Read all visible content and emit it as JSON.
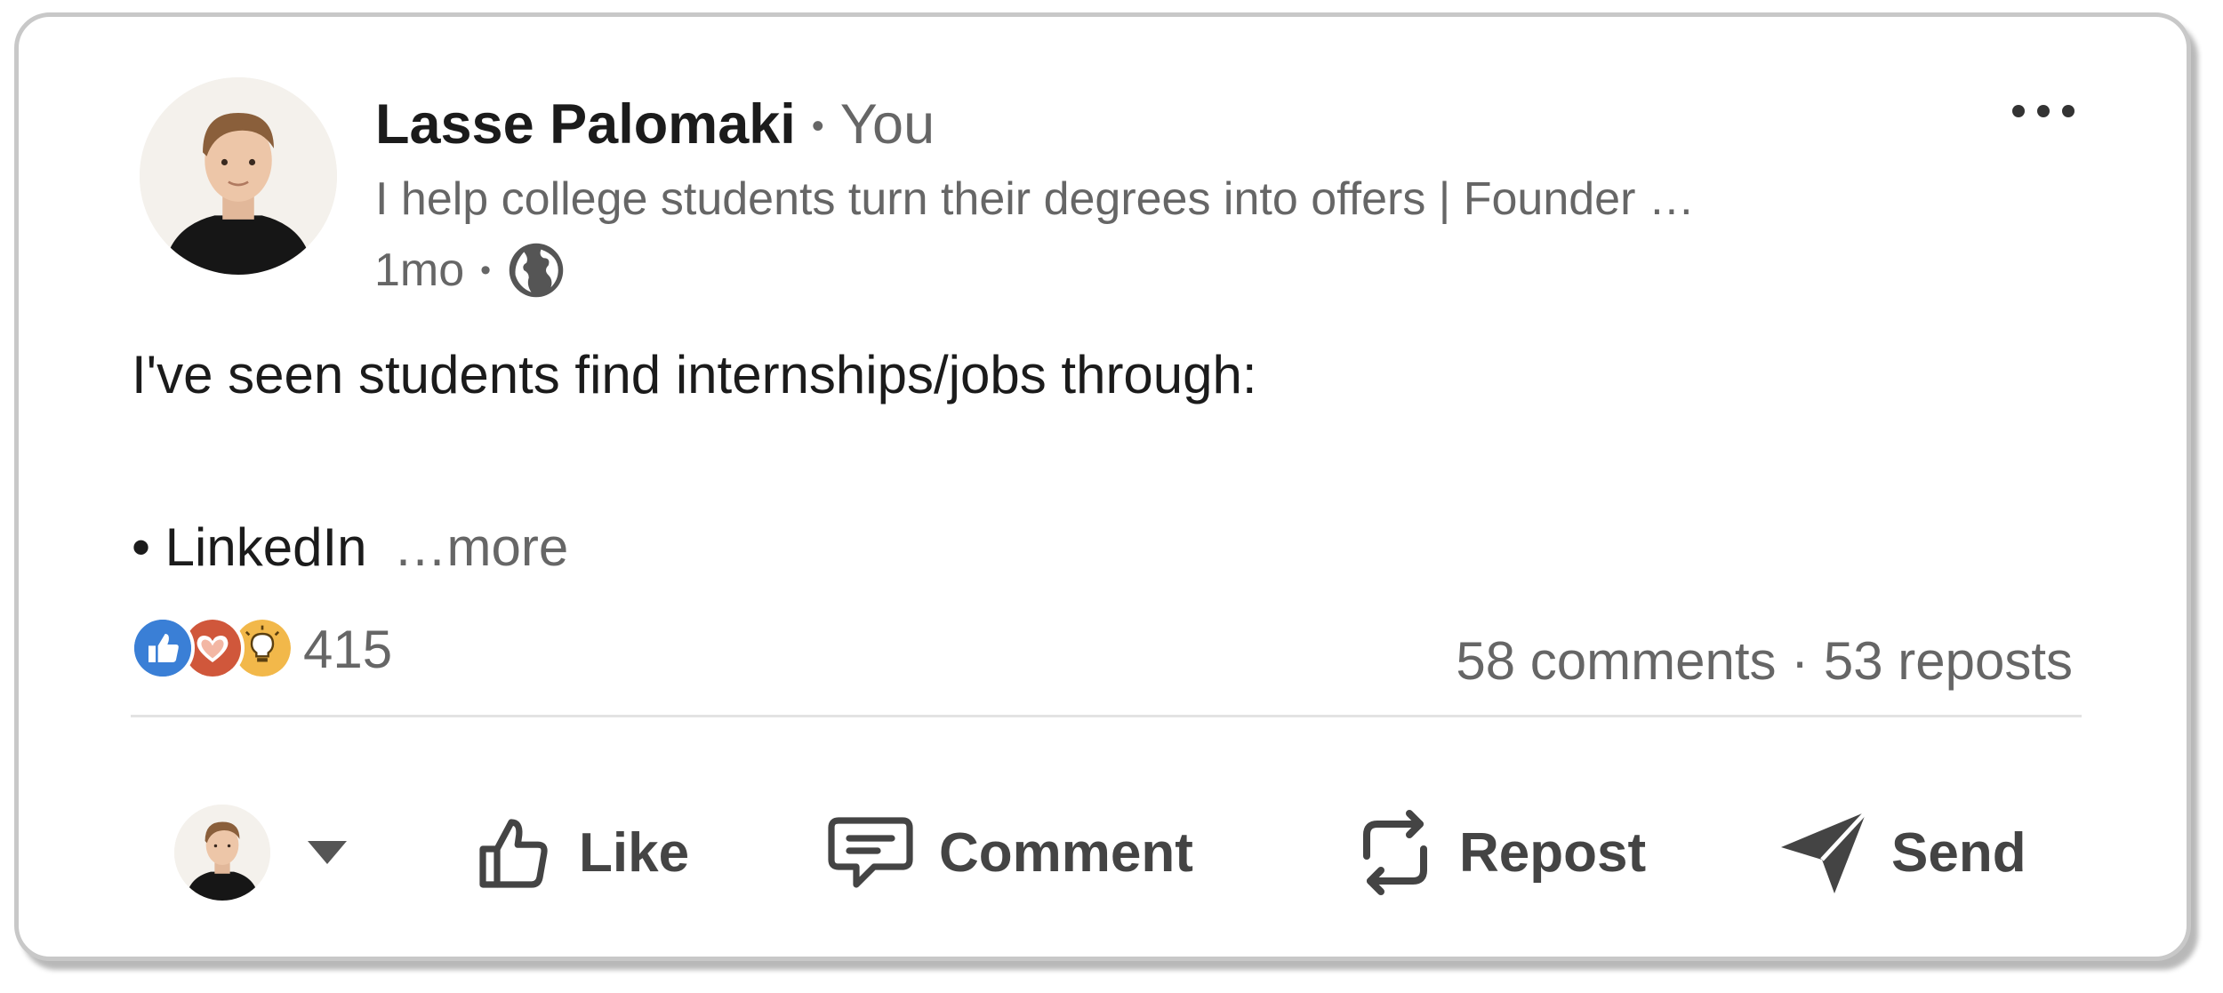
{
  "post": {
    "author": {
      "name": "Lasse Palomaki",
      "relation": "You",
      "headline": "I help college students turn their degrees into offers | Founder …",
      "time": "1mo",
      "visibility_icon": "globe-icon"
    },
    "menu_icon": "more-horizontal-icon",
    "text_line1": "I've seen students find internships/jobs through:",
    "bullet": "• LinkedIn",
    "see_more": "…more",
    "reactions": {
      "icons": [
        "like-reaction-icon",
        "love-reaction-icon",
        "insightful-reaction-icon"
      ],
      "count": "415"
    },
    "comments": "58 comments",
    "separator": "·",
    "reposts": "53 reposts"
  },
  "actions": {
    "like": "Like",
    "comment": "Comment",
    "repost": "Repost",
    "send": "Send"
  },
  "colors": {
    "like_blue": "#3a7fd6",
    "love_red": "#d0573b",
    "insightful_yellow": "#f2b84a",
    "text_primary": "#1b1b1b",
    "text_secondary": "#666666",
    "action_gray": "#444444"
  }
}
